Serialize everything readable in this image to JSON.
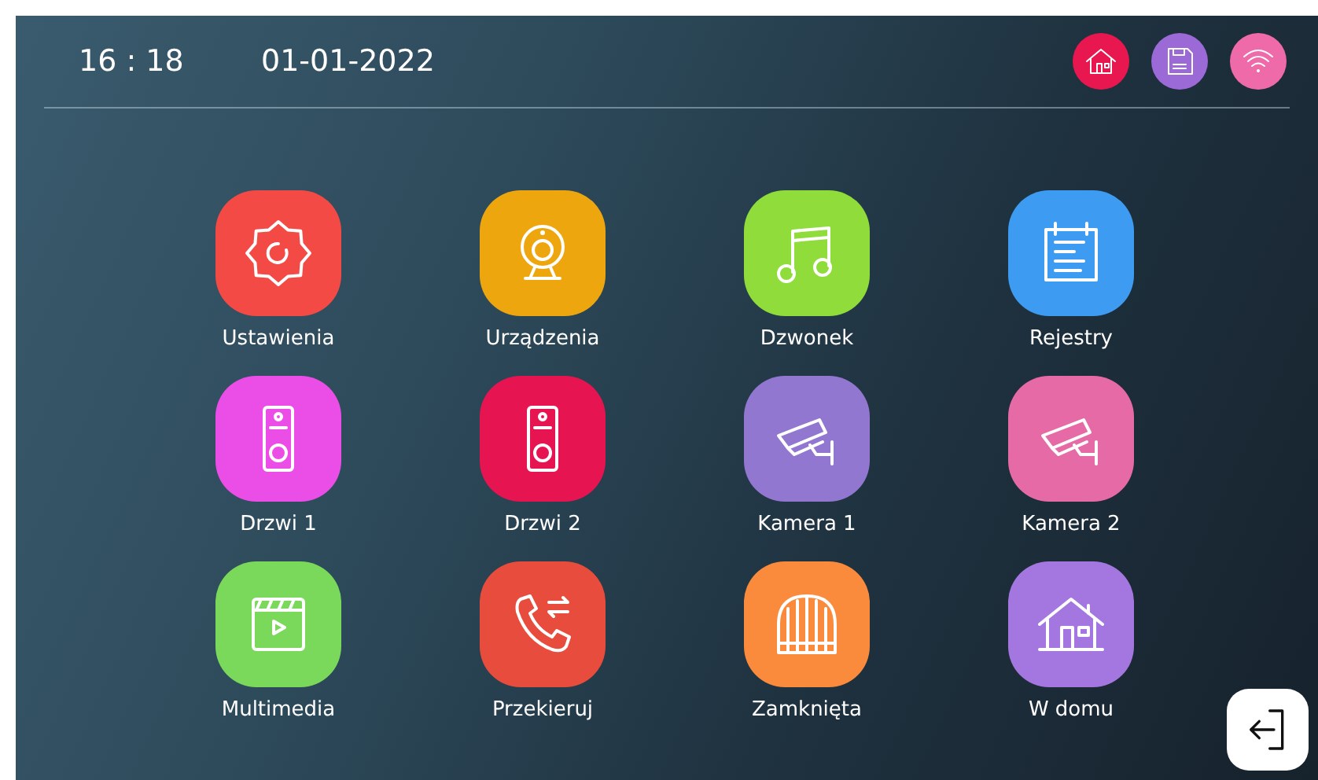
{
  "status_bar": {
    "time": "16 : 18",
    "date": "01-01-2022",
    "indicators": [
      {
        "kind": "home",
        "color": "#e8174f"
      },
      {
        "kind": "floppy",
        "color": "#9b6ad6"
      },
      {
        "kind": "wifi",
        "color": "#ee6aa8"
      }
    ]
  },
  "apps": [
    {
      "label": "Ustawienia",
      "kind": "gear",
      "color": "#f44a45"
    },
    {
      "label": "Urządzenia",
      "kind": "webcam",
      "color": "#eea60f"
    },
    {
      "label": "Dzwonek",
      "kind": "music",
      "color": "#8fdc3b"
    },
    {
      "label": "Rejestry",
      "kind": "notes",
      "color": "#3e9bf2"
    },
    {
      "label": "Drzwi 1",
      "kind": "doorbell",
      "color": "#eb4ee6"
    },
    {
      "label": "Drzwi 2",
      "kind": "doorbell",
      "color": "#e61552"
    },
    {
      "label": "Kamera 1",
      "kind": "camera",
      "color": "#9177d0"
    },
    {
      "label": "Kamera 2",
      "kind": "camera",
      "color": "#e66aa6"
    },
    {
      "label": "Multimedia",
      "kind": "video",
      "color": "#7ad85a"
    },
    {
      "label": "Przekieruj",
      "kind": "phone",
      "color": "#e74c3c"
    },
    {
      "label": "Zamknięta",
      "kind": "gate",
      "color": "#fa8a3c"
    },
    {
      "label": "W domu",
      "kind": "house",
      "color": "#a477e0"
    }
  ],
  "exit_button": {
    "kind": "exit"
  }
}
